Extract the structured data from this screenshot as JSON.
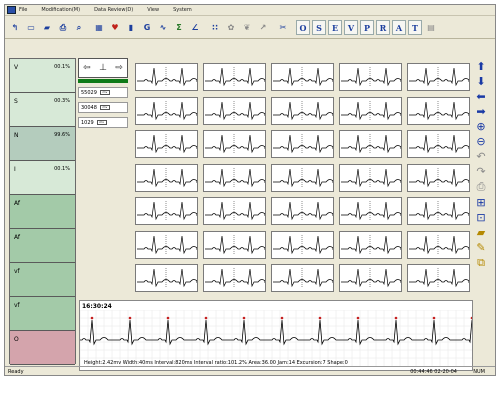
{
  "menubar": {
    "items": [
      "File",
      "Modification(M)",
      "Data Review(D)",
      "View",
      "System"
    ]
  },
  "toolbar": {
    "buttons": [
      {
        "name": "back-icon",
        "glyph": "↰"
      },
      {
        "name": "new-file-icon",
        "glyph": "▭"
      },
      {
        "name": "open-folder-icon",
        "glyph": "▰"
      },
      {
        "name": "print-icon",
        "glyph": "⎙"
      },
      {
        "name": "zoom-icon",
        "glyph": "⌕"
      },
      {
        "name": "sep"
      },
      {
        "name": "grid-icon",
        "glyph": "▦"
      },
      {
        "name": "hr-icon",
        "glyph": "♥"
      },
      {
        "name": "bar-chart-icon",
        "glyph": "▮"
      },
      {
        "name": "gnd-icon",
        "glyph": "G"
      },
      {
        "name": "st-icon",
        "glyph": "∿"
      },
      {
        "name": "sigma-icon",
        "glyph": "Σ"
      },
      {
        "name": "lead-icon",
        "glyph": "∠"
      },
      {
        "name": "sep"
      },
      {
        "name": "dots-icon",
        "glyph": "∷"
      },
      {
        "name": "flower-icon",
        "glyph": "✿"
      },
      {
        "name": "heart-icon",
        "glyph": "❦"
      },
      {
        "name": "arrow-icon",
        "glyph": "↗"
      },
      {
        "name": "sep"
      },
      {
        "name": "tools-icon",
        "glyph": "✂"
      }
    ],
    "letter_buttons": [
      "O",
      "S",
      "E",
      "V",
      "P",
      "R",
      "A",
      "T"
    ],
    "doc_icon": "▤"
  },
  "sidebar": {
    "classes": [
      {
        "label": "V",
        "pct": "00.1%",
        "color": "#d7e9d7"
      },
      {
        "label": "S",
        "pct": "00.3%",
        "color": "#d7e9d7"
      },
      {
        "label": "N",
        "pct": "99.6%",
        "color": "#b4ccbd"
      },
      {
        "label": "I",
        "pct": "00.1%",
        "color": "#d7e9d7"
      },
      {
        "label": "Af",
        "pct": "",
        "color": "#a3caa8"
      },
      {
        "label": "Af",
        "pct": "",
        "color": "#a3caa8"
      },
      {
        "label": "vf",
        "pct": "",
        "color": "#a3caa8"
      },
      {
        "label": "vf",
        "pct": "",
        "color": "#a3caa8"
      },
      {
        "label": "O",
        "pct": "",
        "color": "#d4a4ac"
      }
    ]
  },
  "scale_panel": {
    "rows": [
      "55029",
      "30048",
      "1029"
    ]
  },
  "grid": {
    "rows": 7,
    "cols": 5
  },
  "strip": {
    "time": "16:30:24",
    "measurements": "Height:2.42mv  Width:40ms  Interval:820ms  Interval ratio:101.2%  Area:36.00  Jam:14  Excursion:7  Shape:0"
  },
  "statusbar": {
    "left": "Ready",
    "clock": "00:44:46 02-20-04",
    "mode": "NUM"
  },
  "colors": {
    "ecg_trace": "#000000",
    "marker": "#c41e1e",
    "grid_line": "#e6e6e6"
  }
}
